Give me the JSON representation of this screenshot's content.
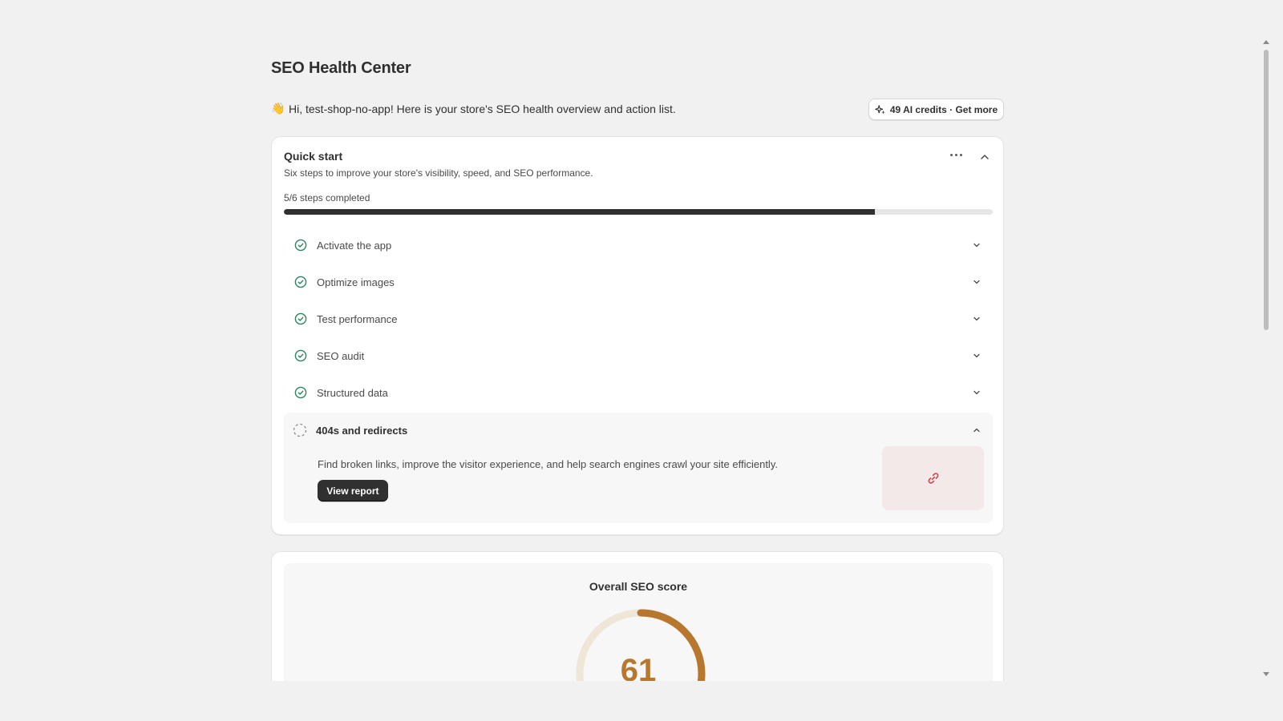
{
  "page": {
    "title": "SEO Health Center",
    "greeting": "Hi, test-shop-no-app! Here is your store's SEO health overview and action list.",
    "greeting_icon": "waving-hand-icon",
    "credits_button": "49 AI credits · Get more"
  },
  "quick_start": {
    "title": "Quick start",
    "subtitle": "Six steps to improve your store's visibility, speed, and SEO performance.",
    "progress_label": "5/6 steps completed",
    "progress_fraction": 0.8333,
    "steps": [
      {
        "label": "Activate the app",
        "status": "completed"
      },
      {
        "label": "Optimize images",
        "status": "completed"
      },
      {
        "label": "Test performance",
        "status": "completed"
      },
      {
        "label": "SEO audit",
        "status": "completed"
      },
      {
        "label": "Structured data",
        "status": "completed"
      }
    ],
    "open_step": {
      "label": "404s and redirects",
      "status": "incomplete",
      "description": "Find broken links, improve the visitor experience, and help search engines crawl your site efficiently.",
      "button": "View report",
      "illustration_icon": "link-icon"
    }
  },
  "score": {
    "title": "Overall SEO score",
    "value": "61",
    "fraction": 0.61
  },
  "colors": {
    "success": "#29845a",
    "score_accent": "#b8772f",
    "score_track": "#efe6d8",
    "link_icon": "#c9464f",
    "primary_button": "#303030"
  }
}
